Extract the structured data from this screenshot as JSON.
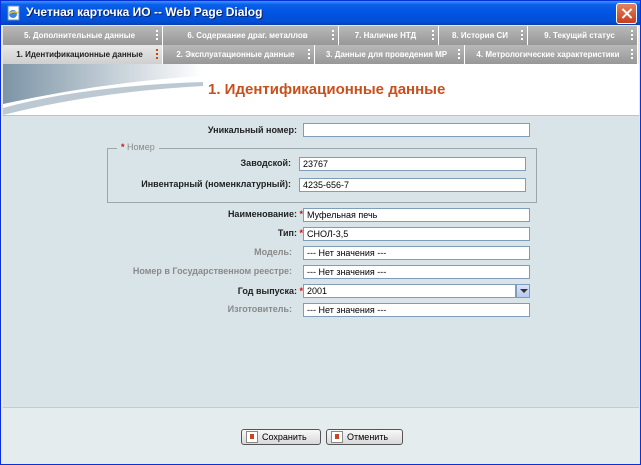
{
  "window": {
    "title": "Учетная карточка ИО -- Web Page Dialog"
  },
  "tabs_row1": [
    {
      "label": "5. Дополнительные данные"
    },
    {
      "label": "6. Содержание драг. металлов"
    },
    {
      "label": "7. Наличие НТД"
    },
    {
      "label": "8. История СИ"
    },
    {
      "label": "9. Текущий статус"
    }
  ],
  "tabs_row2": [
    {
      "label": "1. Идентификационные данные"
    },
    {
      "label": "2. Эксплуатационные данные"
    },
    {
      "label": "3. Данные для проведения МР"
    },
    {
      "label": "4. Метрологические характеристики"
    }
  ],
  "section_title": "1. Идентификационные данные",
  "form": {
    "unique_number": {
      "label": "Уникальный номер:",
      "value": ""
    },
    "number_group": {
      "legend": "Номер",
      "required_mark": "*"
    },
    "factory": {
      "label": "Заводской:",
      "value": "23767"
    },
    "inventory": {
      "label": "Инвентарный (номенклатурный):",
      "value": "4235-656-7"
    },
    "name": {
      "label": "Наименование:",
      "required_mark": "*",
      "value": "Муфельная печь"
    },
    "type": {
      "label": "Тип:",
      "required_mark": "*",
      "value": "СНОЛ-3,5"
    },
    "model": {
      "label": "Модель:",
      "value": "--- Нет значения ---"
    },
    "state_registry": {
      "label": "Номер в Государственном реестре:",
      "value": "--- Нет значения ---"
    },
    "year": {
      "label": "Год выпуска:",
      "required_mark": "*",
      "value": "2001"
    },
    "manufacturer": {
      "label": "Изготовитель:",
      "value": "--- Нет значения ---"
    }
  },
  "buttons": {
    "save": "Сохранить",
    "cancel": "Отменить"
  },
  "colors": {
    "title_bar": "#0054e3",
    "accent": "#c8501c",
    "content_bg": "#d8e4e8",
    "required": "#d01010"
  }
}
